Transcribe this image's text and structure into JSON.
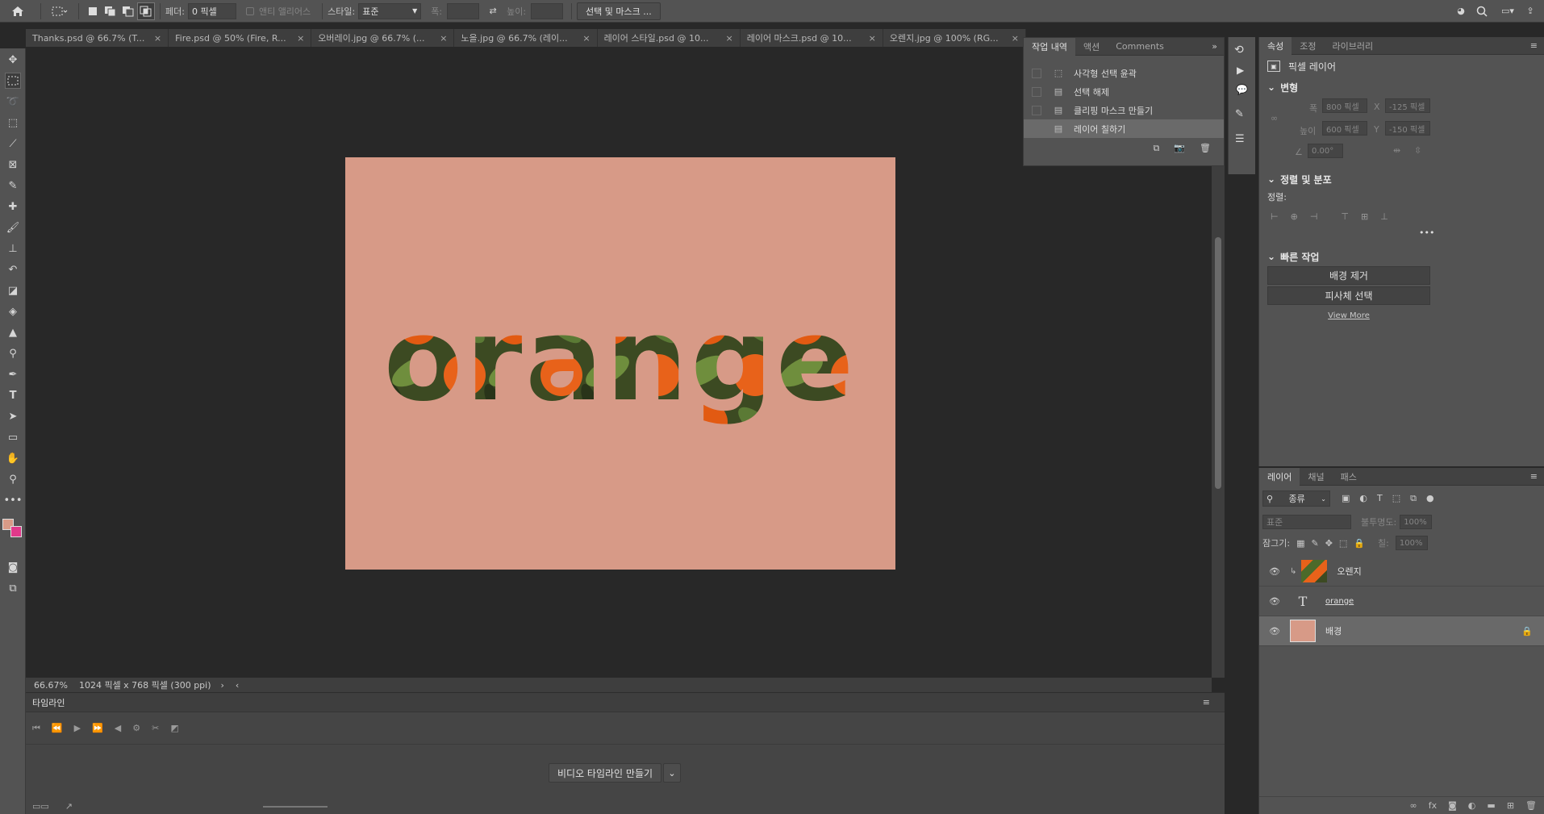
{
  "options_bar": {
    "feather_label": "페더:",
    "feather_value": "0 픽셀",
    "anti_alias_label": "앤티 앨리어스",
    "style_label": "스타일:",
    "style_value": "표준",
    "width_label": "폭:",
    "height_label": "높이:",
    "select_mask_button": "선택 및 마스크 ..."
  },
  "doc_tabs": [
    {
      "label": "Thanks.psd @ 66.7% (T..."
    },
    {
      "label": "Fire.psd @ 50% (Fire, R..."
    },
    {
      "label": "오버레이.jpg @ 66.7% (..."
    },
    {
      "label": "노을.jpg @ 66.7% (레이..."
    },
    {
      "label": "레이어 스타일.psd @ 10..."
    },
    {
      "label": "레이어 마스크.psd @ 10..."
    },
    {
      "label": "오렌지.jpg @ 100% (RG..."
    }
  ],
  "canvas": {
    "word": "orange",
    "background_color": "#d79a87"
  },
  "status": {
    "zoom": "66.67%",
    "doc_info": "1024 픽셀 x 768 픽셀 (300 ppi)"
  },
  "timeline": {
    "title": "타임라인",
    "create_button": "비디오 타임라인 만들기"
  },
  "history_panel": {
    "tabs": [
      "작업 내역",
      "액션",
      "Comments"
    ],
    "items": [
      {
        "label": "사각형 선택 윤곽",
        "icon": "marquee-icon"
      },
      {
        "label": "선택 해제",
        "icon": "doc-icon"
      },
      {
        "label": "클리핑 마스크 만들기",
        "icon": "doc-icon"
      },
      {
        "label": "레이어 칠하기",
        "icon": "doc-icon"
      }
    ]
  },
  "properties_panel": {
    "tabs": [
      "속성",
      "조정",
      "라이브러리"
    ],
    "layer_type": "픽셀 레이어",
    "transform_title": "변형",
    "w_label": "폭",
    "w_value": "800 픽셀",
    "x_label": "X",
    "x_value": "-125 픽셀",
    "h_label": "높이",
    "h_value": "600 픽셀",
    "y_label": "Y",
    "y_value": "-150 픽셀",
    "angle_value": "0.00°",
    "align_title": "정렬 및 분포",
    "align_label": "정렬:",
    "quick_title": "빠른 작업",
    "quick_remove_bg": "배경 제거",
    "quick_select_subject": "피사체 선택",
    "view_more": "View More"
  },
  "layers_panel": {
    "tabs": [
      "레이어",
      "채널",
      "패스"
    ],
    "filter_value": "종류",
    "blend_mode": "표준",
    "opacity_label": "불투명도:",
    "opacity_value": "100%",
    "lock_label": "잠그기:",
    "fill_label": "칠:",
    "fill_value": "100%",
    "layers": [
      {
        "name": "오렌지",
        "kind": "image"
      },
      {
        "name": "orange",
        "kind": "text"
      },
      {
        "name": "배경",
        "kind": "background"
      }
    ]
  },
  "colors": {
    "foreground": "#d79a87",
    "background": "#e0388a",
    "orange": "#e8621a",
    "leaf": "#5b7a35"
  }
}
